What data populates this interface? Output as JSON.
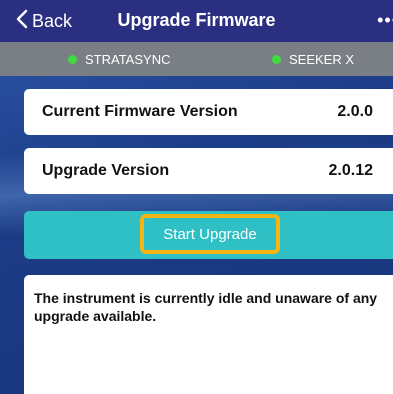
{
  "navbar": {
    "back_label": "Back",
    "title": "Upgrade Firmware",
    "more_label": "•••"
  },
  "devices": [
    {
      "name": "STRATASYNC",
      "status_color": "#3ddc3d"
    },
    {
      "name": "SEEKER X",
      "status_color": "#3ddc3d"
    }
  ],
  "firmware": {
    "current_label": "Current Firmware Version",
    "current_value": "2.0.0",
    "upgrade_label": "Upgrade Version",
    "upgrade_value": "2.0.12"
  },
  "actions": {
    "start_upgrade_label": "Start Upgrade"
  },
  "status": {
    "message": "The instrument is currently idle and unaware of any upgrade available."
  },
  "colors": {
    "navbar": "#2b2f82",
    "statusbar": "#7a7e85",
    "accent_teal": "#2ec0c4",
    "highlight_border": "#f3b414"
  }
}
